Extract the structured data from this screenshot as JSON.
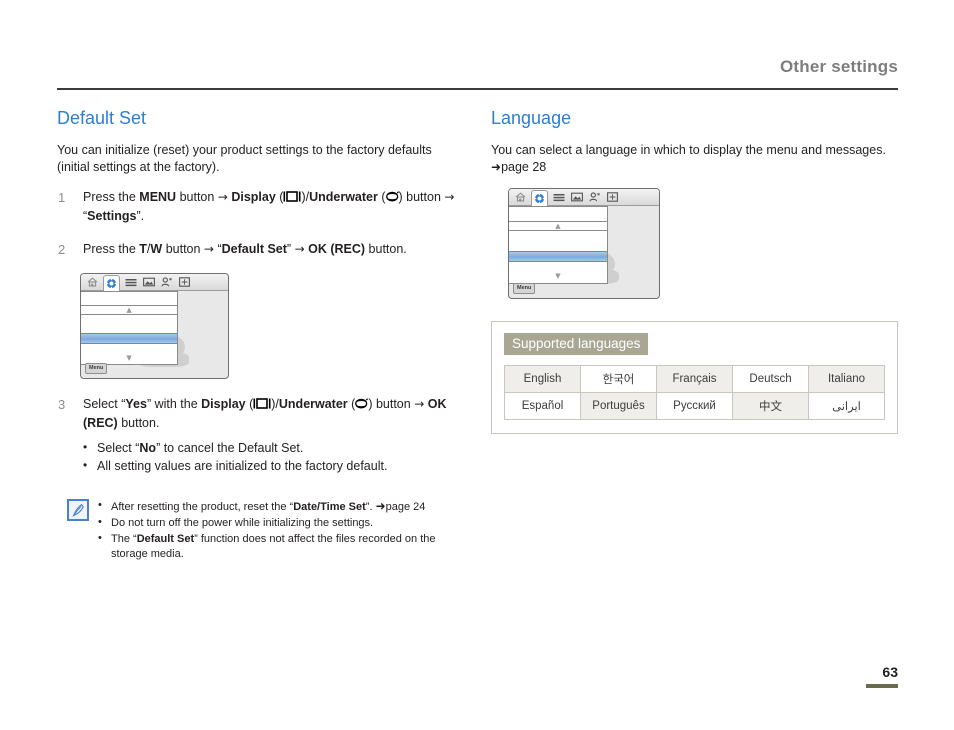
{
  "header": {
    "title": "Other settings"
  },
  "left_column": {
    "section_title": "Default Set",
    "intro": "You can initialize (reset) your product settings to the factory defaults (initial settings at the factory).",
    "steps": [
      {
        "number": "1",
        "parts": {
          "t1": "Press the ",
          "b1": "MENU",
          "t2": " button ",
          "arrow1": "→",
          "t3": " ",
          "b2": "Display",
          "t4": " (",
          "icon1": "display-icon",
          "t5": ")/",
          "b3": "Underwater",
          "t6": " (",
          "icon2": "underwater-icon",
          "t7": ") button ",
          "arrow2": "→",
          "t8": " “",
          "b4": "Settings",
          "t9": "”."
        }
      },
      {
        "number": "2",
        "parts": {
          "t1": "Press the ",
          "b1": "T",
          "t2": "/",
          "b2": "W",
          "t3": " button ",
          "arrow1": "→",
          "t4": " “",
          "b3": "Default Set",
          "t5": "” ",
          "arrow2": "→",
          "t6": " ",
          "b4": "OK (REC)",
          "t7": " button."
        }
      },
      {
        "number": "3",
        "parts": {
          "t1": "Select “",
          "b1": "Yes",
          "t2": "” with the ",
          "b2": "Display",
          "t3": " (",
          "icon1": "display-icon",
          "t4": ")/",
          "b3": "Underwater",
          "t5": " (",
          "icon2": "underwater-icon",
          "t6": ") button ",
          "arrow1": "→",
          "t7": " ",
          "b4": "OK (REC)",
          "t8": " button."
        },
        "sub_bullets": [
          {
            "t1": "Select “",
            "b1": "No",
            "t2": "” to cancel the Default Set."
          },
          {
            "t1": "All setting values are initialized to the factory default.",
            "b1": "",
            "t2": ""
          }
        ]
      }
    ],
    "note": {
      "icon": "note-pen-icon",
      "bullets": [
        {
          "t1": "After resetting the product, reset the “",
          "b1": "Date/Time Set",
          "t2": "”. ",
          "arrow": "➜",
          "t3": "page 24"
        },
        {
          "t1": "Do not turn off the power while initializing the settings.",
          "b1": "",
          "t2": "",
          "arrow": "",
          "t3": ""
        },
        {
          "t1": "The “",
          "b1": "Default Set",
          "t2": "” function does not affect the files recorded on the storage media.",
          "arrow": "",
          "t3": ""
        }
      ]
    }
  },
  "right_column": {
    "section_title": "Language",
    "intro_t1": "You can select a language in which to display the menu and messages. ",
    "intro_arrow": "➜",
    "intro_t2": "page 28",
    "lang_box": {
      "badge": "Supported languages",
      "rows": [
        [
          "English",
          "한국어",
          "Français",
          "Deutsch",
          "Italiano"
        ],
        [
          "Español",
          "Português",
          "Русский",
          "中文",
          "ایرانی"
        ]
      ],
      "shading": [
        [
          "shade",
          "plain",
          "shade",
          "plain",
          "shade"
        ],
        [
          "plain",
          "shade",
          "plain",
          "shade",
          "plain"
        ]
      ]
    }
  },
  "screens": {
    "left": {
      "menu_label": "Menu",
      "tab_icons": [
        "home-icon",
        "gear-icon",
        "list-icon",
        "picture-icon",
        "person-icon",
        "frame-icon"
      ]
    },
    "right": {
      "menu_label": "Menu",
      "tab_icons": [
        "home-icon",
        "gear-icon",
        "list-icon",
        "picture-icon",
        "person-icon",
        "frame-icon"
      ]
    }
  },
  "folio": {
    "page_number": "63"
  },
  "colors": {
    "heading_blue": "#2e7ed2",
    "header_gray": "#7d7d7d",
    "badge_khaki": "#a9a794",
    "folio_rule": "#6b6950",
    "table_shade": "#efeeea",
    "table_border": "#c9c7bb"
  }
}
